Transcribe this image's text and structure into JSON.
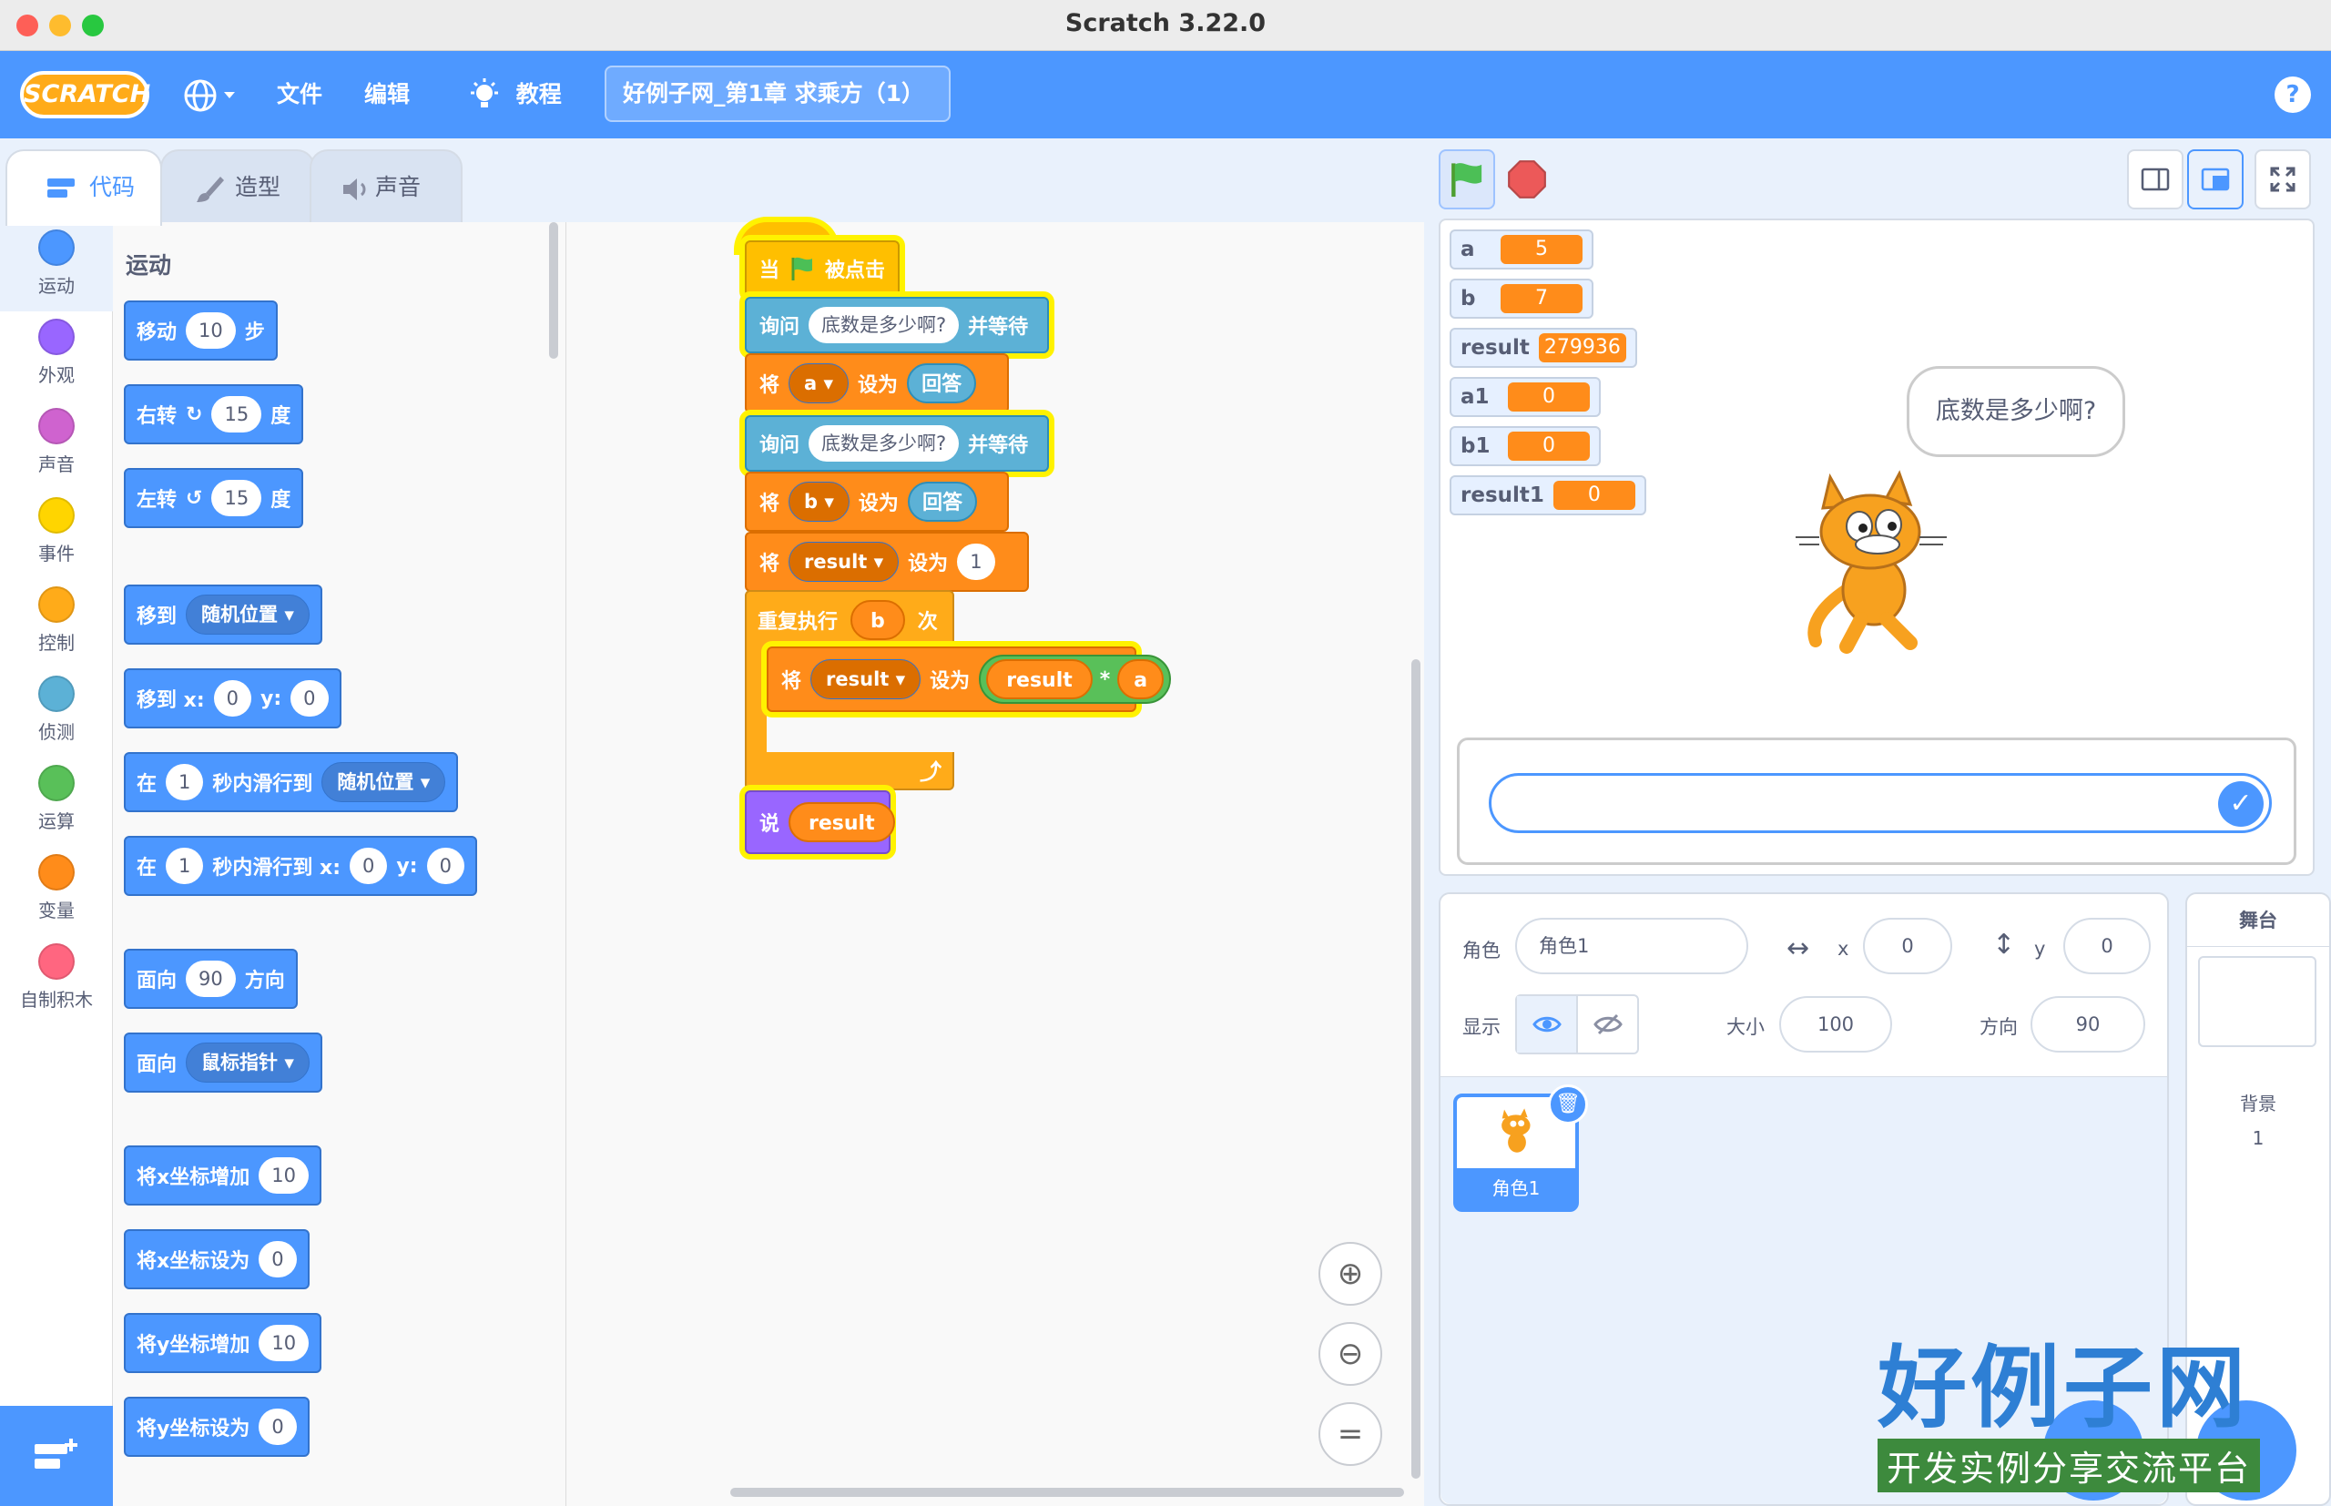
{
  "window": {
    "title": "Scratch 3.22.0"
  },
  "menu": {
    "logo": "SCRATCH",
    "file": "文件",
    "edit": "编辑",
    "tutorials": "教程",
    "project_title": "好例子网_第1章 求乘方（1）",
    "help": "?"
  },
  "tabs": {
    "code": "代码",
    "costumes": "造型",
    "sounds": "声音"
  },
  "categories": [
    {
      "label": "运动",
      "color": "#4c97ff"
    },
    {
      "label": "外观",
      "color": "#9966ff"
    },
    {
      "label": "声音",
      "color": "#cf63cf"
    },
    {
      "label": "事件",
      "color": "#ffd500"
    },
    {
      "label": "控制",
      "color": "#ffab19"
    },
    {
      "label": "侦测",
      "color": "#5cb1d6"
    },
    {
      "label": "运算",
      "color": "#59c059"
    },
    {
      "label": "变量",
      "color": "#ff8c1a"
    },
    {
      "label": "自制积木",
      "color": "#ff6680"
    }
  ],
  "palette": {
    "heading": "运动",
    "move": {
      "pre": "移动",
      "val": "10",
      "post": "步"
    },
    "turn_right": {
      "pre": "右转",
      "val": "15",
      "post": "度"
    },
    "turn_left": {
      "pre": "左转",
      "val": "15",
      "post": "度"
    },
    "goto": {
      "pre": "移到",
      "dd": "随机位置"
    },
    "goto_xy": {
      "pre": "移到 x:",
      "x": "0",
      "y_label": "y:",
      "y": "0"
    },
    "glide": {
      "pre": "在",
      "val": "1",
      "mid": "秒内滑行到",
      "dd": "随机位置"
    },
    "glide_xy": {
      "pre": "在",
      "val": "1",
      "mid": "秒内滑行到 x:",
      "x": "0",
      "y_label": "y:",
      "y": "0"
    },
    "point_dir": {
      "pre": "面向",
      "val": "90",
      "post": "方向"
    },
    "point_towards": {
      "pre": "面向",
      "dd": "鼠标指针"
    },
    "change_x": {
      "pre": "将x坐标增加",
      "val": "10"
    },
    "set_x": {
      "pre": "将x坐标设为",
      "val": "0"
    },
    "change_y": {
      "pre": "将y坐标增加",
      "val": "10"
    },
    "set_y": {
      "pre": "将y坐标设为",
      "val": "0"
    }
  },
  "script": {
    "hat": {
      "pre": "当",
      "post": "被点击"
    },
    "ask1": {
      "pre": "询问",
      "text": "底数是多少啊?",
      "post": "并等待"
    },
    "set_a": {
      "pre": "将",
      "var": "a",
      "mid": "设为",
      "val": "回答"
    },
    "ask2": {
      "pre": "询问",
      "text": "底数是多少啊?",
      "post": "并等待"
    },
    "set_b": {
      "pre": "将",
      "var": "b",
      "mid": "设为",
      "val": "回答"
    },
    "set_result": {
      "pre": "将",
      "var": "result",
      "mid": "设为",
      "val": "1"
    },
    "repeat": {
      "pre": "重复执行",
      "val": "b",
      "post": "次"
    },
    "inner": {
      "pre": "将",
      "var": "result",
      "mid": "设为",
      "left": "result",
      "op": "*",
      "right": "a"
    },
    "say": {
      "pre": "说",
      "val": "result"
    }
  },
  "monitors": [
    {
      "name": "a",
      "value": "5"
    },
    {
      "name": "b",
      "value": "7"
    },
    {
      "name": "result",
      "value": "279936"
    },
    {
      "name": "a1",
      "value": "0"
    },
    {
      "name": "b1",
      "value": "0"
    },
    {
      "name": "result1",
      "value": "0"
    }
  ],
  "speech": "底数是多少啊?",
  "sprite_info": {
    "sprite_label": "角色",
    "sprite_name": "角色1",
    "x_label": "x",
    "x": "0",
    "y_label": "y",
    "y": "0",
    "show_label": "显示",
    "size_label": "大小",
    "size": "100",
    "dir_label": "方向",
    "direction": "90"
  },
  "sprites": [
    {
      "name": "角色1"
    }
  ],
  "stage_panel": {
    "title": "舞台",
    "backdrop_label": "背景",
    "backdrop_count": "1"
  },
  "watermark": {
    "title": "好例子网",
    "subtitle": "开发实例分享交流平台"
  }
}
